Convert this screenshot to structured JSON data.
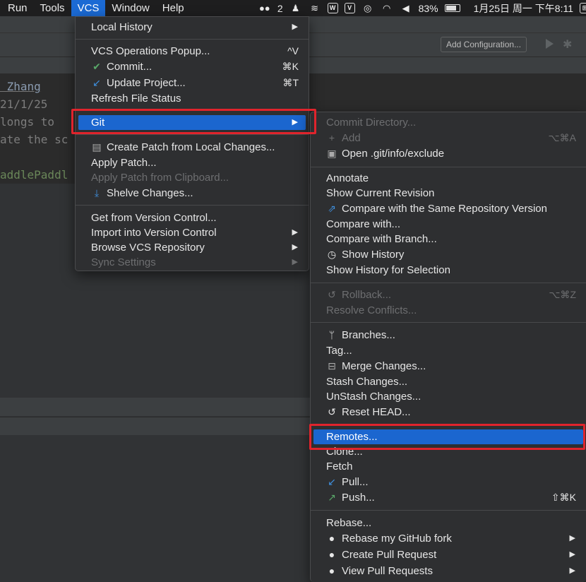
{
  "menubar": {
    "items": [
      "Run",
      "Tools",
      "VCS",
      "Window",
      "Help"
    ],
    "active": "VCS",
    "status": {
      "wechat_badge": "2",
      "battery": "83%",
      "datetime": "1月25日 周一 下午8:11"
    }
  },
  "toolbar": {
    "add_configuration": "Add Configuration..."
  },
  "editor": {
    "lines": [
      " Zhang",
      "21/1/25",
      "longs to",
      "ate the sc",
      "addlePaddl"
    ]
  },
  "vcs_menu": {
    "local_history": "Local History",
    "vcs_operations_popup": "VCS Operations Popup...",
    "vcs_operations_shortcut": "^V",
    "commit": "Commit...",
    "commit_shortcut": "⌘K",
    "update_project": "Update Project...",
    "update_project_shortcut": "⌘T",
    "refresh_file_status": "Refresh File Status",
    "git": "Git",
    "create_patch": "Create Patch from Local Changes...",
    "apply_patch": "Apply Patch...",
    "apply_patch_clipboard": "Apply Patch from Clipboard...",
    "shelve_changes": "Shelve Changes...",
    "get_from_vc": "Get from Version Control...",
    "import_into_vc": "Import into Version Control",
    "browse_vcs_repo": "Browse VCS Repository",
    "sync_settings": "Sync Settings"
  },
  "git_menu": {
    "commit_directory": "Commit Directory...",
    "add": "Add",
    "add_shortcut": "⌥⌘A",
    "open_exclude": "Open .git/info/exclude",
    "annotate": "Annotate",
    "show_current_revision": "Show Current Revision",
    "compare_same_repo": "Compare with the Same Repository Version",
    "compare_with": "Compare with...",
    "compare_with_branch": "Compare with Branch...",
    "show_history": "Show History",
    "show_history_selection": "Show History for Selection",
    "rollback": "Rollback...",
    "rollback_shortcut": "⌥⌘Z",
    "resolve_conflicts": "Resolve Conflicts...",
    "branches": "Branches...",
    "tag": "Tag...",
    "merge_changes": "Merge Changes...",
    "stash_changes": "Stash Changes...",
    "unstash_changes": "UnStash Changes...",
    "reset_head": "Reset HEAD...",
    "remotes": "Remotes...",
    "clone": "Clone...",
    "fetch": "Fetch",
    "pull": "Pull...",
    "push": "Push...",
    "push_shortcut": "⇧⌘K",
    "rebase": "Rebase...",
    "rebase_github_fork": "Rebase my GitHub fork",
    "create_pull_request": "Create Pull Request",
    "view_pull_requests": "View Pull Requests"
  },
  "colors": {
    "selection": "#1b66cf",
    "highlight_box": "#e0242c",
    "menu_bg": "#2e2f31"
  }
}
